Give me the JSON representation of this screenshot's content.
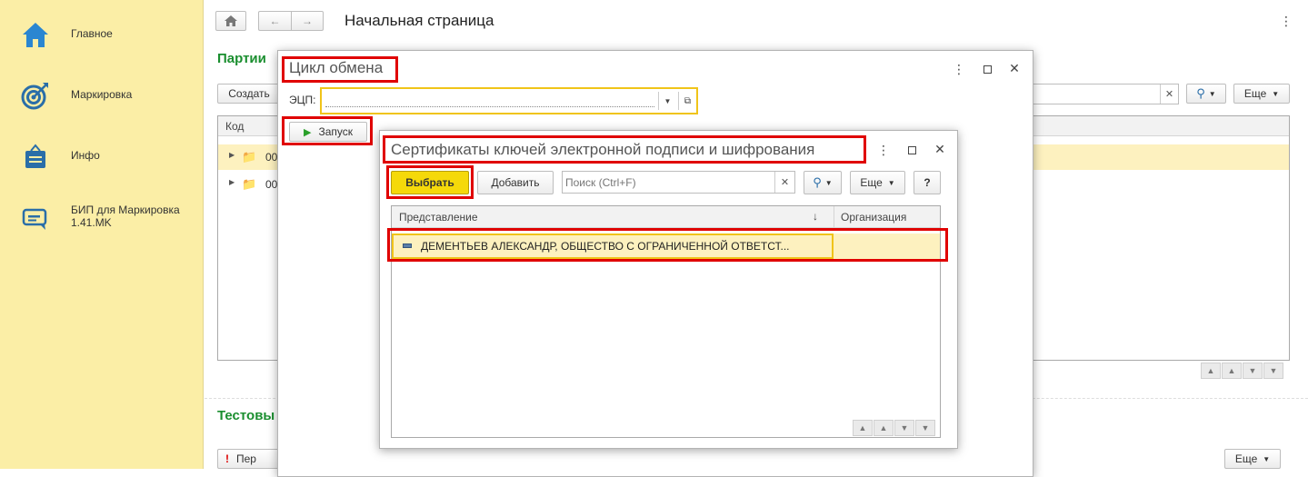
{
  "sidebar": {
    "items": [
      {
        "label": "Главное",
        "icon": "home-icon"
      },
      {
        "label": "Маркировка",
        "icon": "target-icon"
      },
      {
        "label": "Инфо",
        "icon": "bag-icon"
      },
      {
        "label": "БИП для Маркировка 1.41.MK",
        "icon": "message-icon"
      }
    ]
  },
  "header": {
    "title": "Начальная страница"
  },
  "main": {
    "section1_title": "Партии",
    "create_button": "Создать",
    "more_button": "Еще",
    "grid": {
      "col_code": "Код",
      "rows": [
        "00",
        "00"
      ]
    },
    "section2_title": "Тестовы",
    "section2_row_text": "Пер",
    "more_button_2": "Еще"
  },
  "exchange_dialog": {
    "title": "Цикл обмена",
    "ecp_label": "ЭЦП:",
    "ecp_value": "",
    "start_button": "Запуск"
  },
  "cert_dialog": {
    "title": "Сертификаты ключей электронной подписи и шифрования",
    "select_button": "Выбрать",
    "add_button": "Добавить",
    "search_placeholder": "Поиск (Ctrl+F)",
    "more_button": "Еще",
    "help_button": "?",
    "columns": [
      "Представление",
      "Организация"
    ],
    "rows": [
      {
        "representation": "ДЕМЕНТЬЕВ АЛЕКСАНДР, ОБЩЕСТВО С ОГРАНИЧЕННОЙ ОТВЕТСТ...",
        "organization": ""
      }
    ]
  },
  "colors": {
    "sidebar_bg": "#fbeea6",
    "accent_green": "#1a8e2f",
    "select_yellow": "#f5d90a",
    "highlight_red": "#e00000",
    "row_highlight": "#fdf1bf"
  }
}
